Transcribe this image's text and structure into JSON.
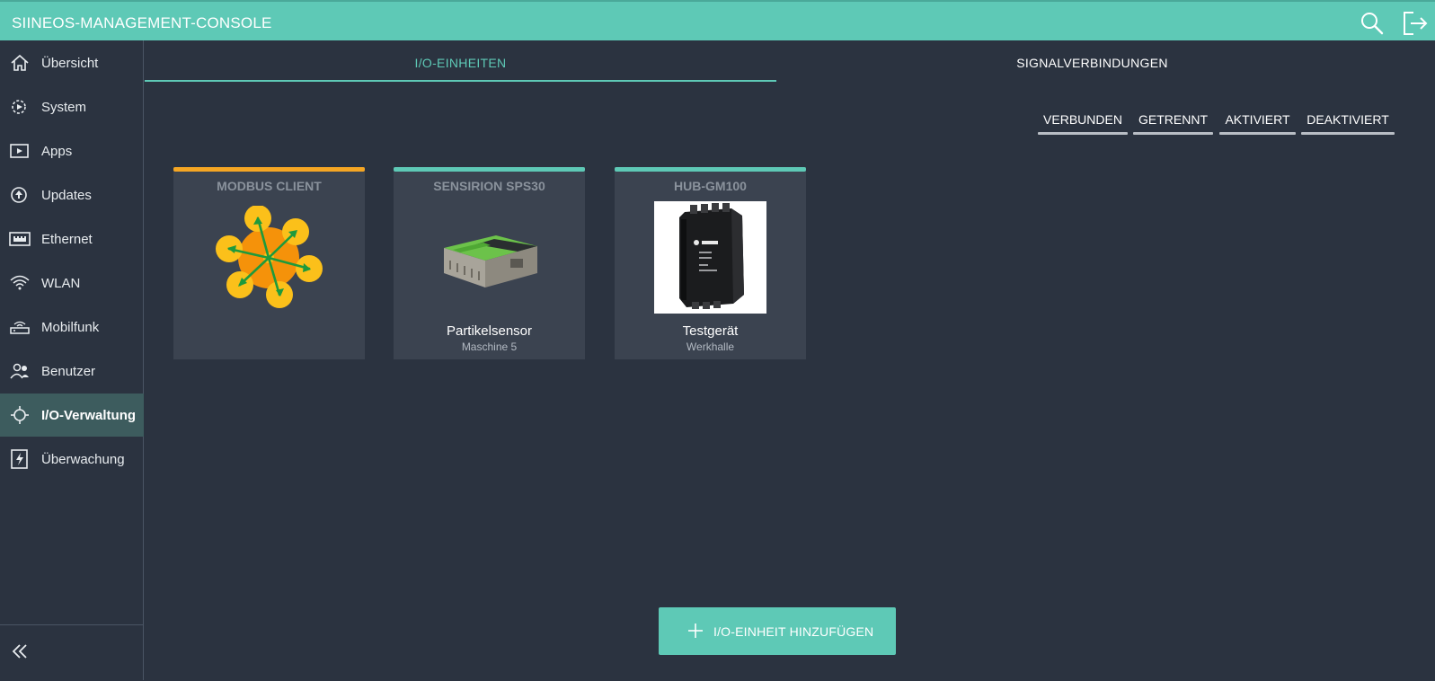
{
  "app": {
    "title": "SIINEOS-MANAGEMENT-CONSOLE"
  },
  "header": {
    "search_icon": "search-icon",
    "logout_icon": "logout-icon"
  },
  "sidebar": {
    "items": [
      {
        "label": "Übersicht",
        "icon": "home-icon"
      },
      {
        "label": "System",
        "icon": "system-settings-icon"
      },
      {
        "label": "Apps",
        "icon": "apps-play-icon"
      },
      {
        "label": "Updates",
        "icon": "upload-arrow-icon"
      },
      {
        "label": "Ethernet",
        "icon": "ethernet-port-icon"
      },
      {
        "label": "WLAN",
        "icon": "wifi-icon"
      },
      {
        "label": "Mobilfunk",
        "icon": "cellular-router-icon"
      },
      {
        "label": "Benutzer",
        "icon": "users-icon"
      },
      {
        "label": "I/O-Verwaltung",
        "icon": "io-management-icon",
        "active": true
      },
      {
        "label": "Überwachung",
        "icon": "monitoring-icon"
      }
    ],
    "collapse_icon": "double-chevron-left-icon"
  },
  "tabs": [
    {
      "label": "I/O-EINHEITEN",
      "active": true
    },
    {
      "label": "SIGNALVERBINDUNGEN",
      "active": false
    }
  ],
  "filters": [
    "VERBUNDEN",
    "GETRENNT",
    "AKTIVIERT",
    "DEAKTIVIERT"
  ],
  "cards": [
    {
      "title": "MODBUS CLIENT",
      "name": "",
      "subtitle": "",
      "status_color": "#f5a623",
      "image": "modbus-network-icon"
    },
    {
      "title": "SENSIRION SPS30",
      "name": "Partikelsensor",
      "subtitle": "Maschine 5",
      "status_color": "#5ec9b6",
      "image": "particle-sensor-image"
    },
    {
      "title": "HUB-GM100",
      "name": "Testgerät",
      "subtitle": "Werkhalle",
      "status_color": "#5ec9b6",
      "image": "hub-device-image"
    }
  ],
  "add_button": {
    "label": "I/O-EINHEIT HINZUFÜGEN",
    "icon": "plus-icon"
  },
  "colors": {
    "accent": "#5ec9b6",
    "background": "#2b3340",
    "card": "#3b4350",
    "warning": "#f5a623"
  }
}
